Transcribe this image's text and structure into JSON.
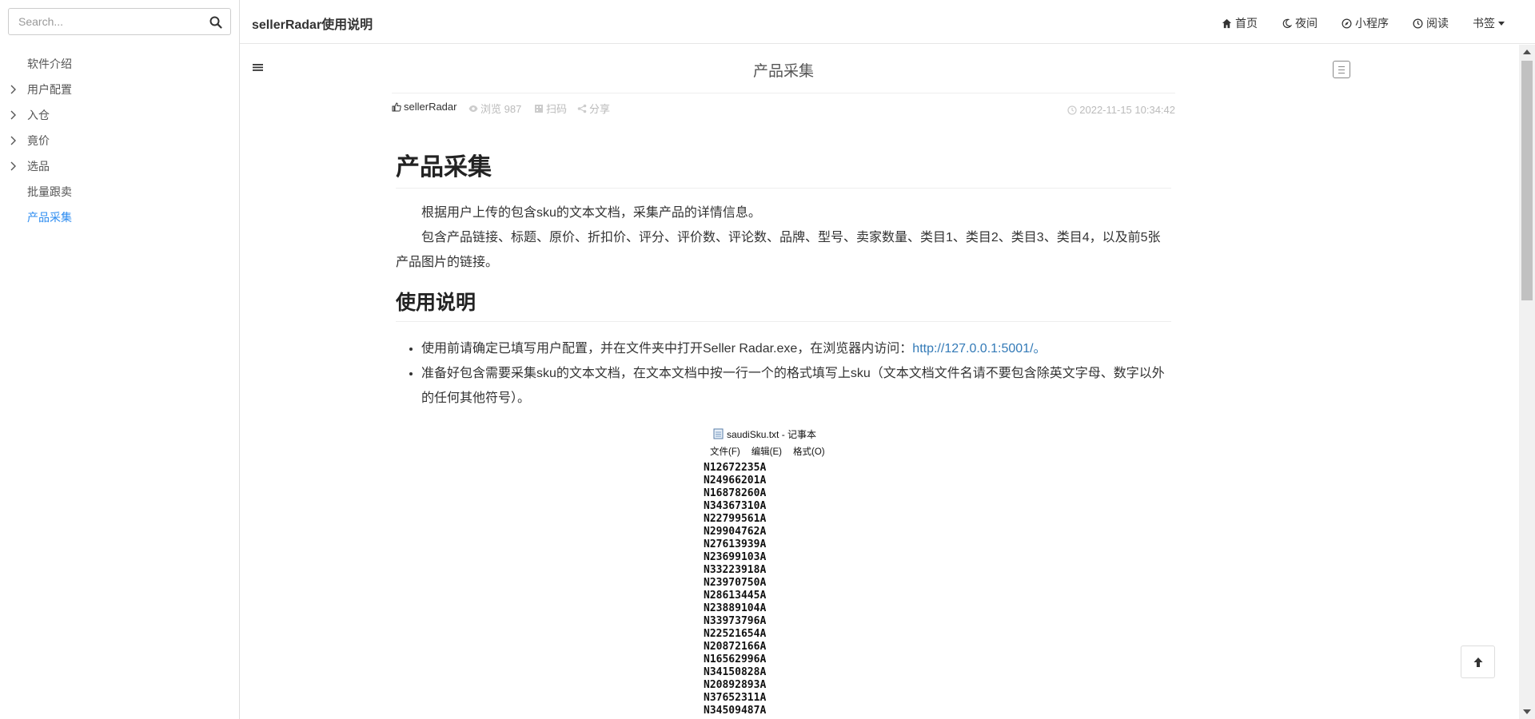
{
  "colors": {
    "accent": "#2d8cf0",
    "link": "#337ab7",
    "muted": "#bbbbbb"
  },
  "search": {
    "placeholder": "Search...",
    "icon": "search-icon"
  },
  "sidebar": {
    "items": [
      {
        "label": "软件介绍",
        "expandable": false,
        "active": false
      },
      {
        "label": "用户配置",
        "expandable": true,
        "active": false
      },
      {
        "label": "入仓",
        "expandable": true,
        "active": false
      },
      {
        "label": "竟价",
        "expandable": true,
        "active": false
      },
      {
        "label": "选品",
        "expandable": true,
        "active": false
      },
      {
        "label": "批量跟卖",
        "expandable": false,
        "active": false
      },
      {
        "label": "产品采集",
        "expandable": false,
        "active": true
      }
    ]
  },
  "header": {
    "title": "sellerRadar使用说明",
    "menu": {
      "home": {
        "label": "首页",
        "icon": "home-icon"
      },
      "night": {
        "label": "夜间",
        "icon": "moon-icon"
      },
      "miniprogram": {
        "label": "小程序",
        "icon": "compass-icon"
      },
      "read": {
        "label": "阅读",
        "icon": "clock-icon"
      },
      "bookmark": {
        "label": "书签",
        "icon": "caret-down-icon"
      }
    }
  },
  "doc": {
    "title": "产品采集",
    "meta": {
      "author": "sellerRadar",
      "views_label": "浏览 987",
      "scan_label": "扫码",
      "share_label": "分享",
      "date": "2022-11-15 10:34:42"
    },
    "h1": "产品采集",
    "p1": "根据用户上传的包含sku的文本文档，采集产品的详情信息。",
    "p2": "包含产品链接、标题、原价、折扣价、评分、评价数、评论数、品牌、型号、卖家数量、类目1、类目2、类目3、类目4，以及前5张产品图片的链接。",
    "h2": "使用说明",
    "list": {
      "item1_prefix": "使用前请确定已填写用户配置，并在文件夹中打开Seller Radar.exe，在浏览器内访问：",
      "item1_link": "http://127.0.0.1:5001/",
      "item1_suffix": "。",
      "item2": "准备好包含需要采集sku的文本文档，在文本文档中按一行一个的格式填写上sku（文本文档文件名请不要包含除英文字母、数字以外的任何其他符号）。"
    }
  },
  "notepad": {
    "title": "saudiSku.txt - 记事本",
    "menu": [
      "文件(F)",
      "编辑(E)",
      "格式(O)"
    ],
    "lines": [
      "N12672235A",
      "N24966201A",
      "N16878260A",
      "N34367310A",
      "N22799561A",
      "N29904762A",
      "N27613939A",
      "N23699103A",
      "N33223918A",
      "N23970750A",
      "N28613445A",
      "N23889104A",
      "N33973796A",
      "N22521654A",
      "N20872166A",
      "N16562996A",
      "N34150828A",
      "N20892893A",
      "N37652311A",
      "N34509487A"
    ]
  }
}
